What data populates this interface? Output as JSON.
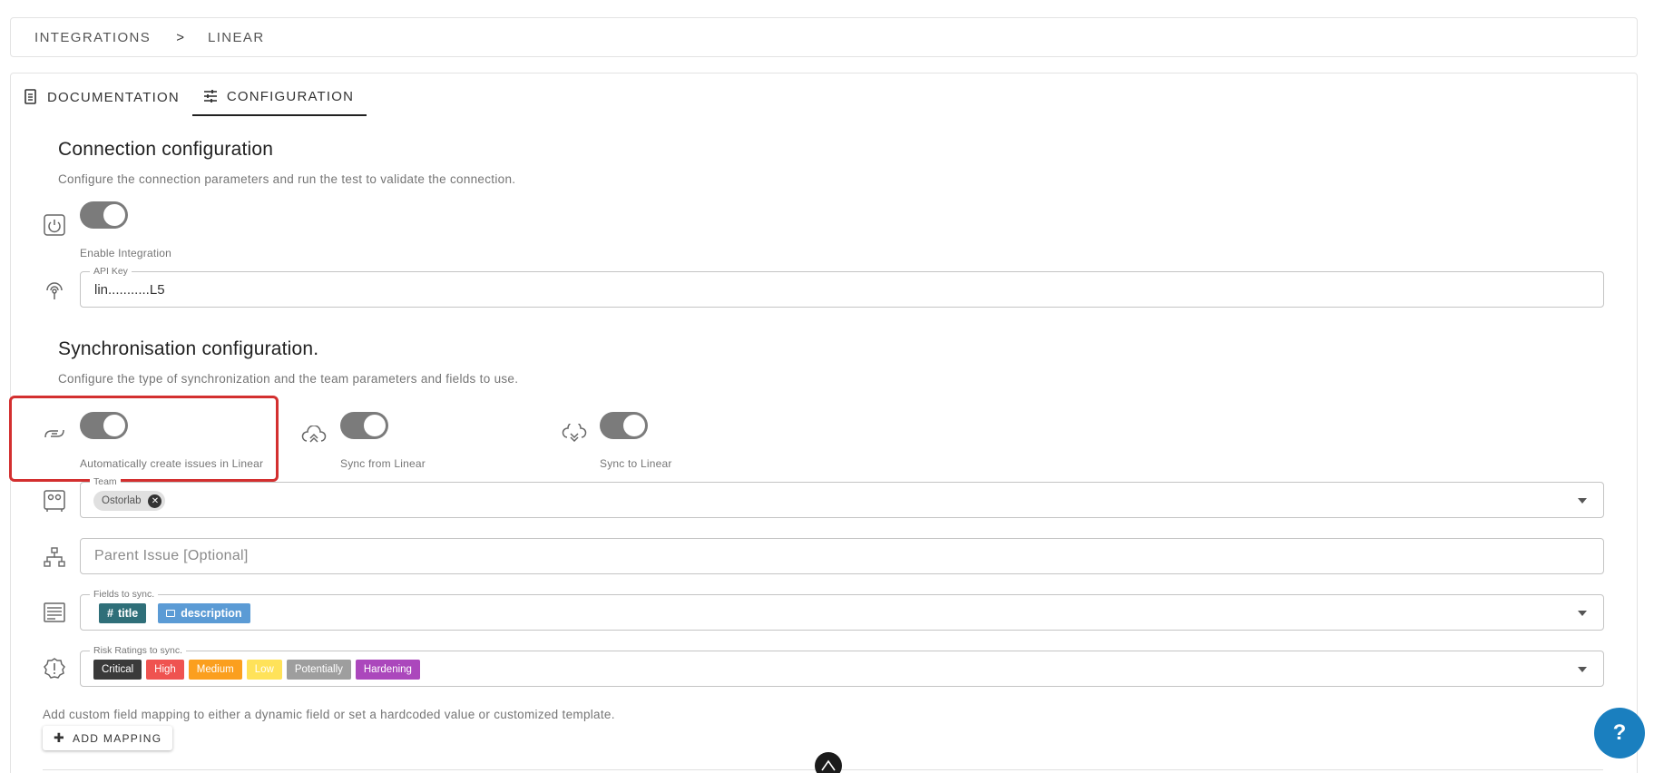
{
  "breadcrumb": {
    "root": "INTEGRATIONS",
    "separator": ">",
    "current": "LINEAR"
  },
  "tabs": [
    {
      "label": "DOCUMENTATION",
      "icon": "document-icon",
      "active": false
    },
    {
      "label": "CONFIGURATION",
      "icon": "sliders-icon",
      "active": true
    }
  ],
  "connection": {
    "title": "Connection configuration",
    "description": "Configure the connection parameters and run the test to validate the connection.",
    "enable_label": "Enable Integration",
    "api_key_label": "API Key",
    "api_key_value": "lin...........L5"
  },
  "sync": {
    "title": "Synchronisation configuration.",
    "description": "Configure the type of synchronization and the team parameters and fields to use.",
    "toggles": [
      {
        "label": "Automatically create issues in Linear",
        "icon": "link-icon",
        "on": true
      },
      {
        "label": "Sync from Linear",
        "icon": "cloud-upload-icon",
        "on": true
      },
      {
        "label": "Sync to Linear",
        "icon": "cloud-download-icon",
        "on": true
      }
    ],
    "team_label": "Team",
    "team_value": "Ostorlab",
    "parent_issue_placeholder": "Parent Issue [Optional]",
    "fields_label": "Fields to sync.",
    "fields": [
      {
        "label": "title",
        "icon": "hash-icon",
        "color": "#2f6f79"
      },
      {
        "label": "description",
        "icon": "text-icon",
        "color": "#5b9bd5"
      }
    ],
    "risk_label": "Risk Ratings to sync.",
    "risks": [
      {
        "label": "Critical",
        "color": "#3a3a3a"
      },
      {
        "label": "High",
        "color": "#ef5350"
      },
      {
        "label": "Medium",
        "color": "#fb9f1e"
      },
      {
        "label": "Low",
        "color": "#ffe259"
      },
      {
        "label": "Potentially",
        "color": "#9e9e9e"
      },
      {
        "label": "Hardening",
        "color": "#ab47bc"
      }
    ]
  },
  "mapping": {
    "description": "Add custom field mapping to either a dynamic field or set a hardcoded value or customized template.",
    "add_label": "ADD MAPPING"
  },
  "help": {
    "label": "?"
  }
}
